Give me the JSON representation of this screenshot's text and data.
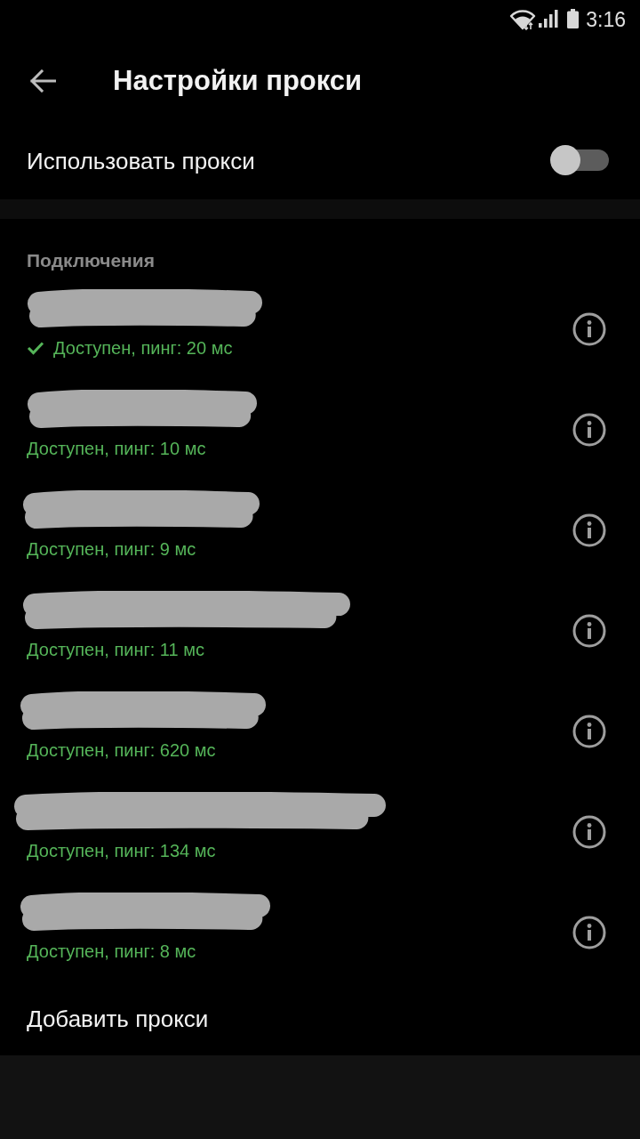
{
  "status_bar": {
    "time": "3:16"
  },
  "app_bar": {
    "title": "Настройки прокси"
  },
  "use_proxy": {
    "label": "Использовать прокси",
    "on": false
  },
  "connections": {
    "header": "Подключения",
    "items": [
      {
        "status": "Доступен, пинг: 20 мс",
        "selected": true
      },
      {
        "status": "Доступен, пинг: 10 мс",
        "selected": false
      },
      {
        "status": "Доступен, пинг: 9 мс",
        "selected": false
      },
      {
        "status": "Доступен, пинг: 11 мс",
        "selected": false
      },
      {
        "status": "Доступен, пинг: 620 мс",
        "selected": false
      },
      {
        "status": "Доступен, пинг: 134 мс",
        "selected": false
      },
      {
        "status": "Доступен, пинг: 8 мс",
        "selected": false
      }
    ]
  },
  "add_proxy": {
    "label": "Добавить прокси"
  }
}
